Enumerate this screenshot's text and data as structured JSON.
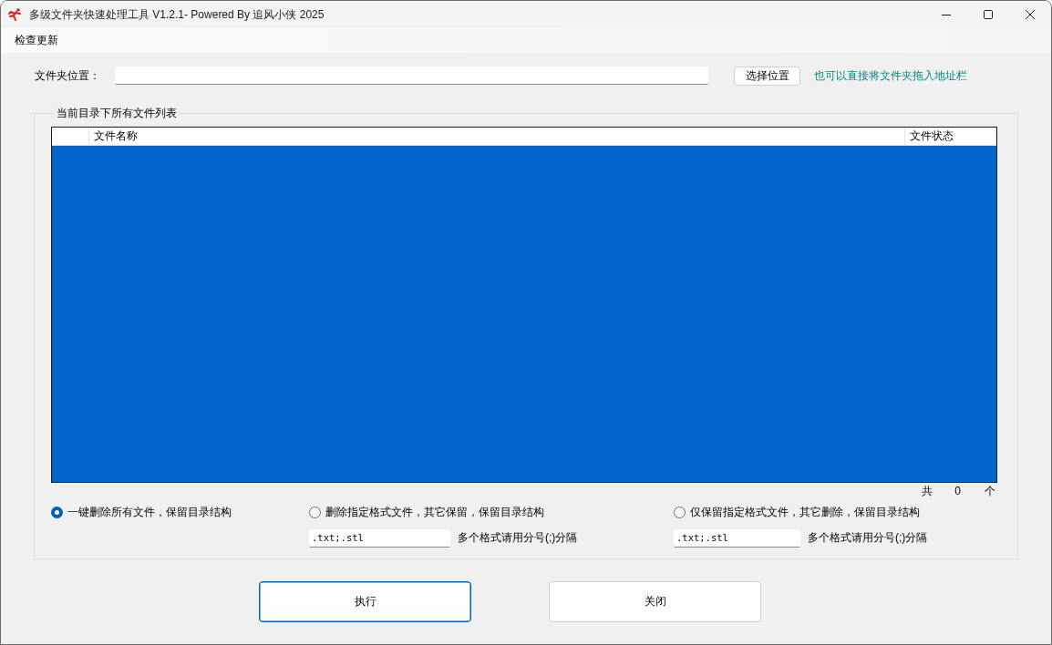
{
  "window": {
    "title": "多级文件夹快速处理工具 V1.2.1- Powered By 追风小侠 2025"
  },
  "menu": [
    "检查更新"
  ],
  "folder": {
    "label": "文件夹位置：",
    "browse_button": "选择位置",
    "hint": "也可以直接将文件夹拖入地址栏"
  },
  "file_list": {
    "title": "当前目录下所有文件列表",
    "columns": [
      "文件名称",
      "文件状态"
    ],
    "count": {
      "prefix": "共",
      "value": "0",
      "suffix": "个"
    }
  },
  "modes": [
    {
      "label": "一键删除所有文件，保留目录结构",
      "selected": true
    },
    {
      "label": "删除指定格式文件，其它保留，保留目录结构",
      "selected": false,
      "extensions": ".txt;.stl",
      "extensions_hint": "多个格式请用分号(;)分隔"
    },
    {
      "label": "仅保留指定格式文件，其它删除，保留目录结构",
      "selected": false,
      "extensions": ".txt;.stl",
      "extensions_hint": "多个格式请用分号(;)分隔"
    }
  ],
  "buttons": [
    {
      "label": "执行",
      "focused": true
    },
    {
      "label": "关闭",
      "focused": false
    }
  ]
}
